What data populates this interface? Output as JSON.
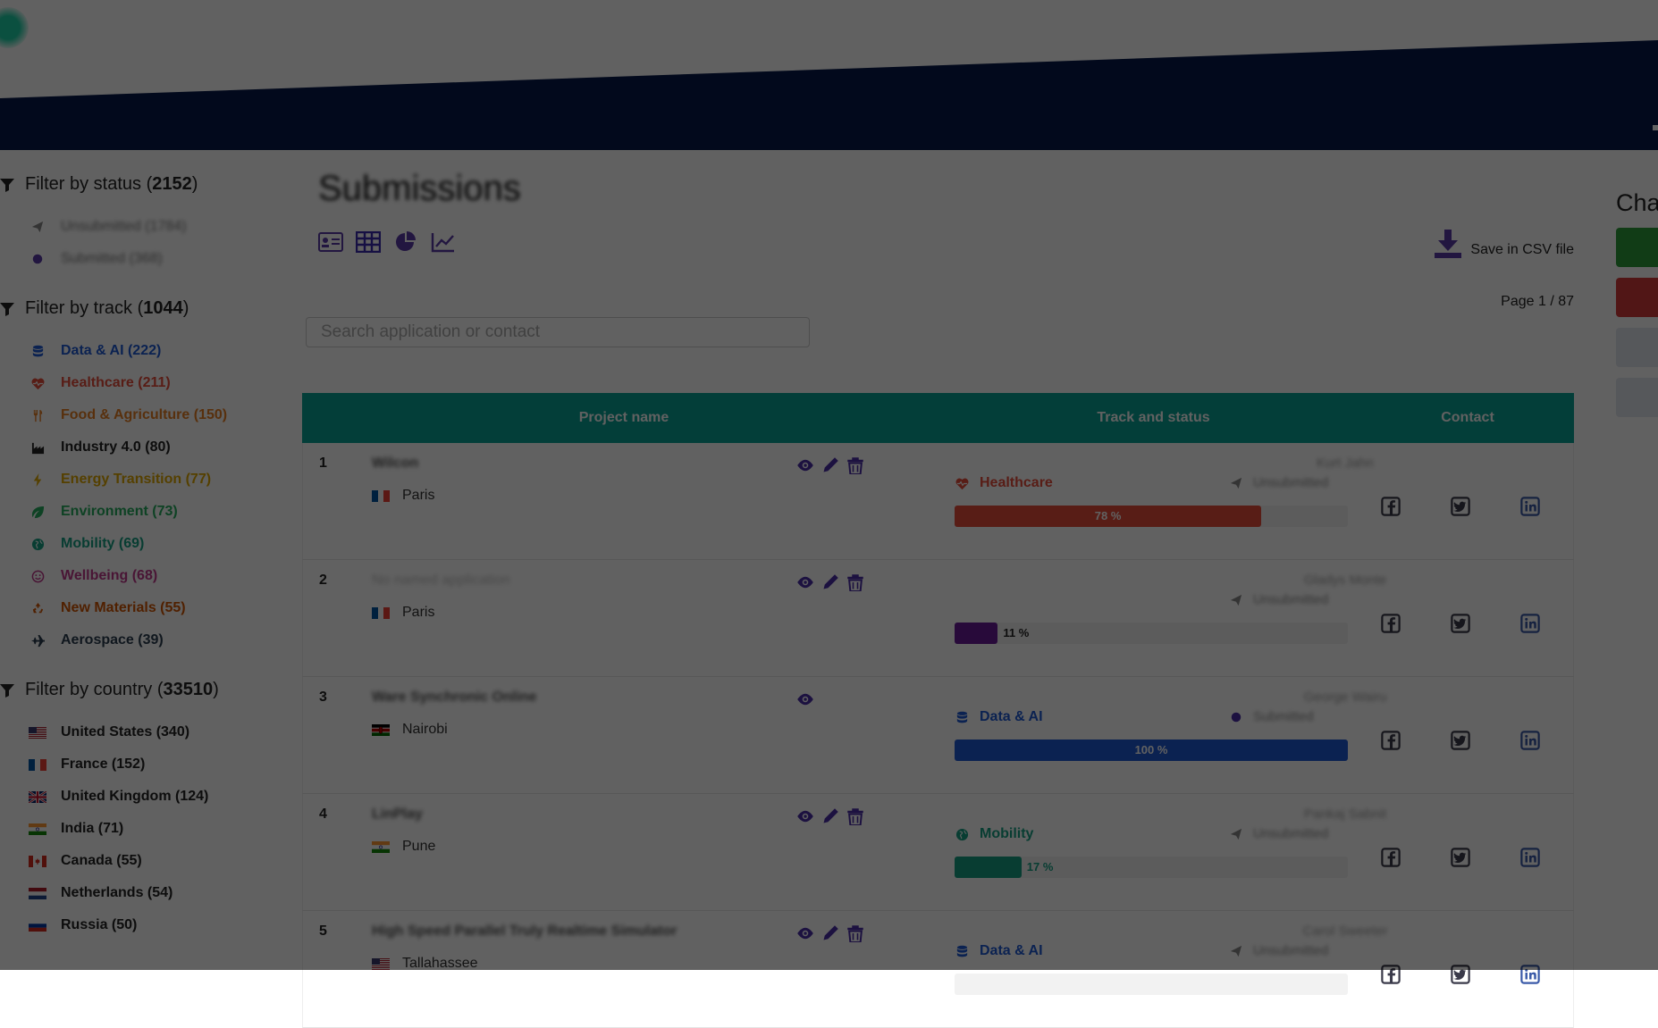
{
  "sidebar": {
    "status": {
      "title_prefix": "Filter by status (",
      "count": "2152",
      "title_suffix": ")",
      "items": [
        {
          "label": "Unsubmitted (1784)",
          "icon": "paper-plane-icon",
          "color": "#888888"
        },
        {
          "label": "Submitted (368)",
          "icon": "circle-icon",
          "color": "#5b3aa8"
        }
      ]
    },
    "track": {
      "title_prefix": "Filter by track (",
      "count": "1044",
      "title_suffix": ")",
      "items": [
        {
          "label": "Data & AI (222)",
          "icon": "database-icon",
          "color": "#1f5ad6"
        },
        {
          "label": "Healthcare (211)",
          "icon": "heartbeat-icon",
          "color": "#e74c3c"
        },
        {
          "label": "Food & Agriculture (150)",
          "icon": "utensils-icon",
          "color": "#e67e22"
        },
        {
          "label": "Industry 4.0 (80)",
          "icon": "factory-icon",
          "color": "#222222"
        },
        {
          "label": "Energy Transition (77)",
          "icon": "bolt-icon",
          "color": "#e0a800"
        },
        {
          "label": "Environment (73)",
          "icon": "leaf-icon",
          "color": "#27ae60"
        },
        {
          "label": "Mobility (69)",
          "icon": "globe-icon",
          "color": "#16a085"
        },
        {
          "label": "Wellbeing (68)",
          "icon": "smile-icon",
          "color": "#c0398b"
        },
        {
          "label": "New Materials (55)",
          "icon": "recycle-icon",
          "color": "#d35400"
        },
        {
          "label": "Aerospace (39)",
          "icon": "plane-icon",
          "color": "#2c3e50"
        }
      ]
    },
    "country": {
      "title_prefix": "Filter by country (",
      "count": "33510",
      "title_suffix": ")",
      "items": [
        {
          "label": "United States (340)",
          "flag": "us"
        },
        {
          "label": "France (152)",
          "flag": "fr"
        },
        {
          "label": "United Kingdom (124)",
          "flag": "gb"
        },
        {
          "label": "India (71)",
          "flag": "in"
        },
        {
          "label": "Canada (55)",
          "flag": "ca"
        },
        {
          "label": "Netherlands (54)",
          "flag": "nl"
        },
        {
          "label": "Russia (50)",
          "flag": "ru"
        }
      ]
    }
  },
  "main": {
    "title": "Submissions",
    "csv_label": "Save in CSV file",
    "page_indicator": "Page 1 / 87",
    "search_placeholder": "Search application or contact",
    "columns": {
      "project": "Project name",
      "track": "Track and status",
      "contact": "Contact"
    }
  },
  "rows": [
    {
      "num": "1",
      "name": "Wilcon",
      "name_faint": false,
      "city": "Paris",
      "flag": "fr",
      "actions": [
        "view",
        "edit",
        "delete"
      ],
      "track": "Healthcare",
      "track_icon": "heartbeat-icon",
      "track_color": "#e74c3c",
      "status": "Unsubmitted",
      "progress": 78,
      "progress_label": "78 %",
      "bar_color": "#e74c3c",
      "label_inside": true,
      "contact": "Kurt Jahn"
    },
    {
      "num": "2",
      "name": "No named application",
      "name_faint": true,
      "city": "Paris",
      "flag": "fr",
      "actions": [
        "view",
        "edit",
        "delete"
      ],
      "track": "",
      "track_icon": "",
      "track_color": "#888888",
      "status": "Unsubmitted",
      "progress": 11,
      "progress_label": "11 %",
      "bar_color": "#6a1b9a",
      "label_inside": false,
      "contact": "Gladys Monte"
    },
    {
      "num": "3",
      "name": "Ware Synchronic Online",
      "name_faint": false,
      "city": "Nairobi",
      "flag": "ke",
      "actions": [
        "view"
      ],
      "track": "Data & AI",
      "track_icon": "database-icon",
      "track_color": "#1f5ad6",
      "status": "Submitted",
      "progress": 100,
      "progress_label": "100 %",
      "bar_color": "#1f5ad6",
      "label_inside": true,
      "contact": "George Wairu"
    },
    {
      "num": "4",
      "name": "LinPlay",
      "name_faint": false,
      "city": "Pune",
      "flag": "in",
      "actions": [
        "view",
        "edit",
        "delete"
      ],
      "track": "Mobility",
      "track_icon": "globe-icon",
      "track_color": "#16a085",
      "status": "Unsubmitted",
      "progress": 17,
      "progress_label": "17 %",
      "bar_color": "#16a085",
      "label_inside": false,
      "contact": "Pankaj Sabnit"
    },
    {
      "num": "5",
      "name": "High Speed Parallel Truly Realtime Simulator",
      "name_faint": false,
      "city": "Tallahassee",
      "flag": "us",
      "actions": [
        "view",
        "edit",
        "delete"
      ],
      "track": "Data & AI",
      "track_icon": "database-icon",
      "track_color": "#1f5ad6",
      "status": "Unsubmitted",
      "progress": 0,
      "progress_label": "",
      "bar_color": "#1f5ad6",
      "label_inside": false,
      "contact": "Carol Sweeter"
    }
  ],
  "right_panel": {
    "title": "Cha",
    "buttons": [
      {
        "color": "#2e9e3c"
      },
      {
        "color": "#d63a3a"
      },
      {
        "color": "#e3e7ee"
      },
      {
        "color": "#e3e7ee"
      }
    ]
  }
}
